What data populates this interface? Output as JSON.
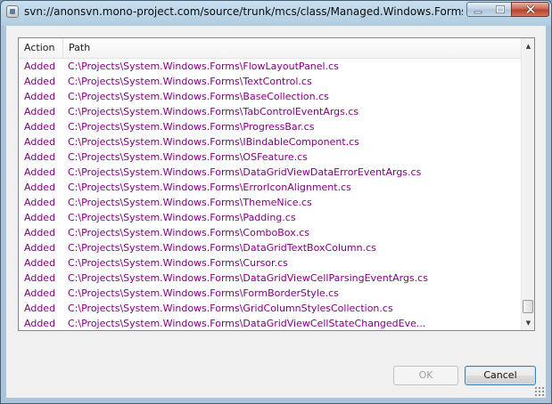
{
  "window": {
    "title": "svn://anonsvn.mono-project.com/source/trunk/mcs/class/Managed.Windows.Forms - Tortoi",
    "controls": {
      "minimize": "–",
      "maximize": "□",
      "close": "✕"
    }
  },
  "table": {
    "columns": {
      "action": "Action",
      "path": "Path"
    },
    "rows": [
      {
        "action": "Added",
        "path": "C:\\Projects\\System.Windows.Forms\\FlowLayoutPanel.cs"
      },
      {
        "action": "Added",
        "path": "C:\\Projects\\System.Windows.Forms\\TextControl.cs"
      },
      {
        "action": "Added",
        "path": "C:\\Projects\\System.Windows.Forms\\BaseCollection.cs"
      },
      {
        "action": "Added",
        "path": "C:\\Projects\\System.Windows.Forms\\TabControlEventArgs.cs"
      },
      {
        "action": "Added",
        "path": "C:\\Projects\\System.Windows.Forms\\ProgressBar.cs"
      },
      {
        "action": "Added",
        "path": "C:\\Projects\\System.Windows.Forms\\IBindableComponent.cs"
      },
      {
        "action": "Added",
        "path": "C:\\Projects\\System.Windows.Forms\\OSFeature.cs"
      },
      {
        "action": "Added",
        "path": "C:\\Projects\\System.Windows.Forms\\DataGridViewDataErrorEventArgs.cs"
      },
      {
        "action": "Added",
        "path": "C:\\Projects\\System.Windows.Forms\\ErrorIconAlignment.cs"
      },
      {
        "action": "Added",
        "path": "C:\\Projects\\System.Windows.Forms\\ThemeNice.cs"
      },
      {
        "action": "Added",
        "path": "C:\\Projects\\System.Windows.Forms\\Padding.cs"
      },
      {
        "action": "Added",
        "path": "C:\\Projects\\System.Windows.Forms\\ComboBox.cs"
      },
      {
        "action": "Added",
        "path": "C:\\Projects\\System.Windows.Forms\\DataGridTextBoxColumn.cs"
      },
      {
        "action": "Added",
        "path": "C:\\Projects\\System.Windows.Forms\\Cursor.cs"
      },
      {
        "action": "Added",
        "path": "C:\\Projects\\System.Windows.Forms\\DataGridViewCellParsingEventArgs.cs"
      },
      {
        "action": "Added",
        "path": "C:\\Projects\\System.Windows.Forms\\FormBorderStyle.cs"
      },
      {
        "action": "Added",
        "path": "C:\\Projects\\System.Windows.Forms\\GridColumnStylesCollection.cs"
      },
      {
        "action": "Added",
        "path": "C:\\Projects\\System.Windows.Forms\\DataGridViewCellStateChangedEve..."
      }
    ]
  },
  "buttons": {
    "ok": "OK",
    "cancel": "Cancel"
  },
  "colors": {
    "added_text": "#800080"
  }
}
